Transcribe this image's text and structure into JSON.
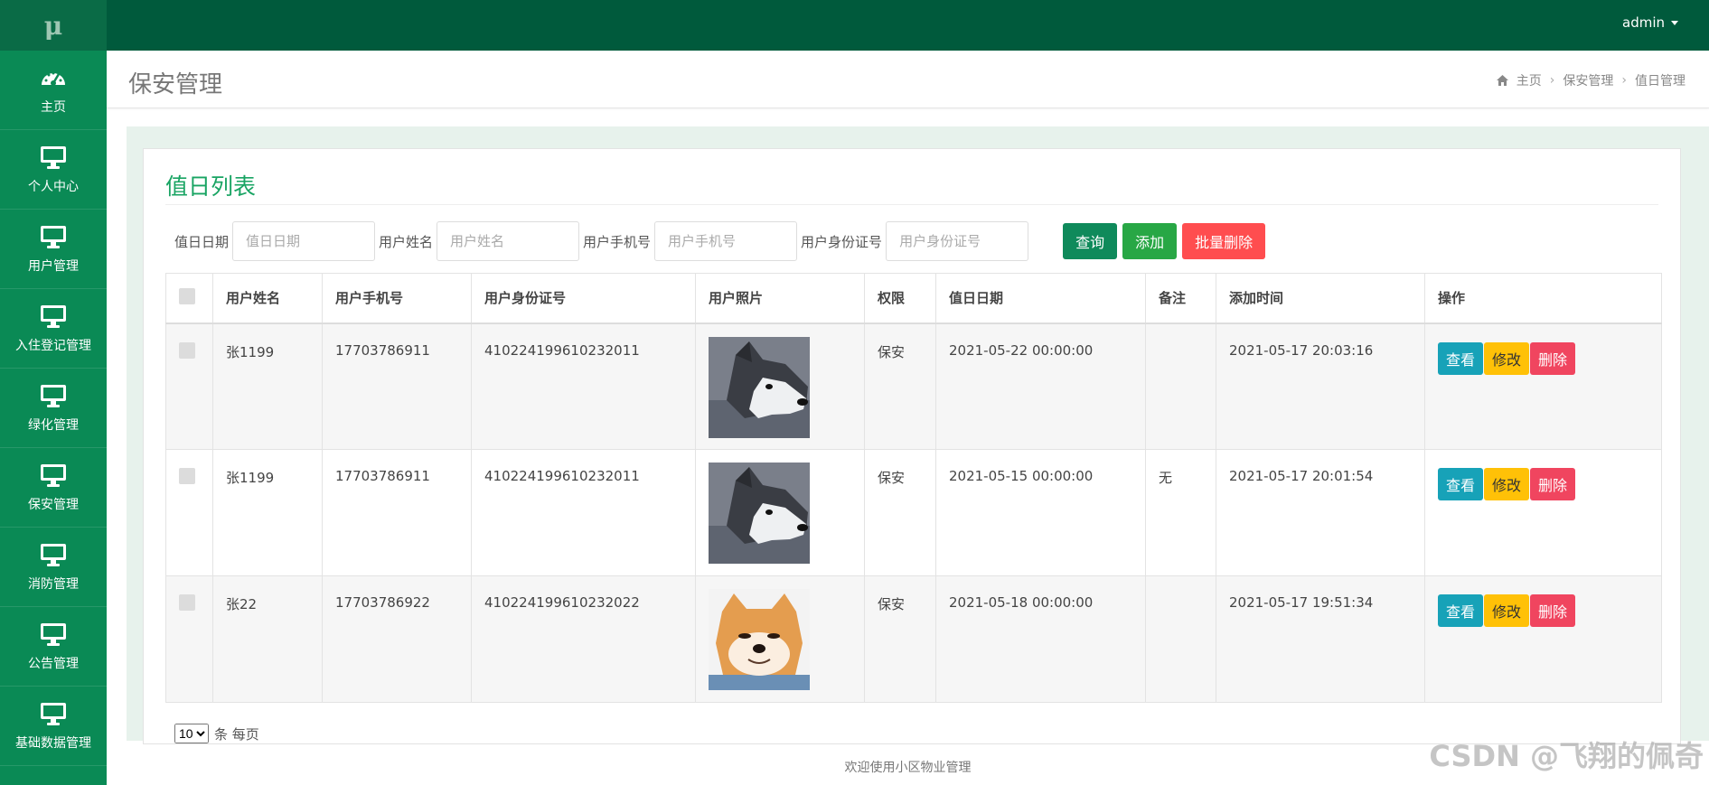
{
  "app": {
    "logo": "μ",
    "user": "admin"
  },
  "sidebar": {
    "items": [
      {
        "label": "主页",
        "icon": "dashboard-icon"
      },
      {
        "label": "个人中心",
        "icon": "monitor-icon"
      },
      {
        "label": "用户管理",
        "icon": "monitor-icon"
      },
      {
        "label": "入住登记管理",
        "icon": "monitor-icon"
      },
      {
        "label": "绿化管理",
        "icon": "monitor-icon"
      },
      {
        "label": "保安管理",
        "icon": "monitor-icon"
      },
      {
        "label": "消防管理",
        "icon": "monitor-icon"
      },
      {
        "label": "公告管理",
        "icon": "monitor-icon"
      },
      {
        "label": "基础数据管理",
        "icon": "monitor-icon"
      }
    ]
  },
  "header": {
    "title": "保安管理",
    "breadcrumb": [
      "主页",
      "保安管理",
      "值日管理"
    ]
  },
  "card": {
    "title": "值日列表"
  },
  "search": {
    "date_label": "值日日期",
    "date_placeholder": "值日日期",
    "name_label": "用户姓名",
    "name_placeholder": "用户姓名",
    "phone_label": "用户手机号",
    "phone_placeholder": "用户手机号",
    "idcard_label": "用户身份证号",
    "idcard_placeholder": "用户身份证号",
    "query_label": "查询",
    "add_label": "添加",
    "batch_delete_label": "批量删除"
  },
  "table": {
    "headers": [
      "用户姓名",
      "用户手机号",
      "用户身份证号",
      "用户照片",
      "权限",
      "值日日期",
      "备注",
      "添加时间",
      "操作"
    ],
    "rows": [
      {
        "name": "张1199",
        "phone": "17703786911",
        "idcard": "410224199610232011",
        "photo": "husky",
        "role": "保安",
        "duty_date": "2021-05-22 00:00:00",
        "note": "",
        "added": "2021-05-17 20:03:16"
      },
      {
        "name": "张1199",
        "phone": "17703786911",
        "idcard": "410224199610232011",
        "photo": "husky",
        "role": "保安",
        "duty_date": "2021-05-15 00:00:00",
        "note": "无",
        "added": "2021-05-17 20:01:54"
      },
      {
        "name": "张22",
        "phone": "17703786922",
        "idcard": "410224199610232022",
        "photo": "shiba",
        "role": "保安",
        "duty_date": "2021-05-18 00:00:00",
        "note": "",
        "added": "2021-05-17 19:51:34"
      }
    ],
    "actions": {
      "view": "查看",
      "edit": "修改",
      "delete": "删除"
    }
  },
  "pager": {
    "page_size": "10",
    "suffix": "条 每页"
  },
  "footer": {
    "text": "欢迎使用小区物业管理"
  },
  "watermark": "CSDN @飞翔的佩奇",
  "colors": {
    "topbar": "#005a3c",
    "sidebar": "#0a8a55",
    "accent": "#19a463",
    "query": "#0f8a5b",
    "add": "#28a745",
    "batch_delete": "#ff4d4f"
  }
}
